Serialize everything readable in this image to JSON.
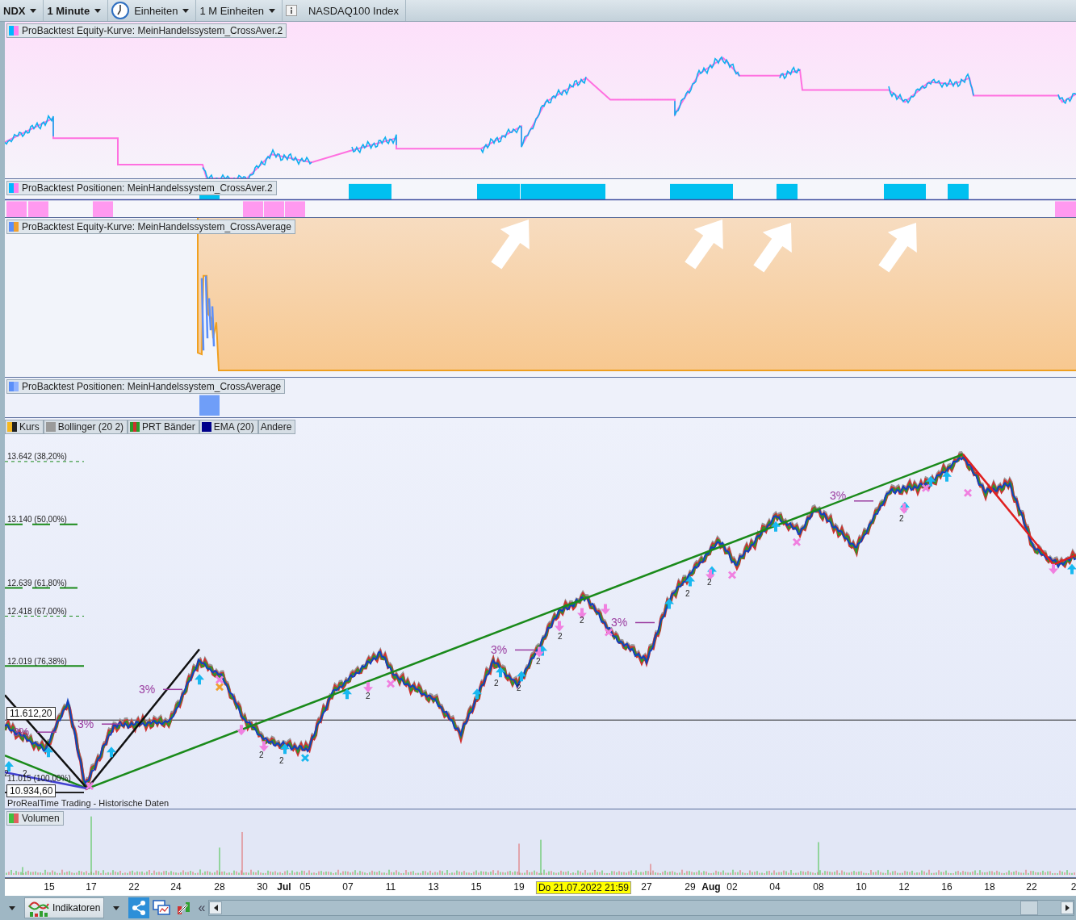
{
  "toolbar": [
    {
      "label": "NDX",
      "kind": "dropdown"
    },
    {
      "label": "1 Minute",
      "kind": "dropdown"
    },
    {
      "label": "Einheiten",
      "kind": "clock"
    },
    {
      "label": "1 M Einheiten",
      "kind": "dropdown"
    },
    {
      "label": "NASDAQ100 Index",
      "kind": "info"
    }
  ],
  "panels": [
    {
      "title": "ProBacktest Equity-Kurve: MeinHandelssystem_CrossAver.2",
      "kind": "equity-pink"
    },
    {
      "title": "ProBacktest Positionen: MeinHandelssystem_CrossAver.2",
      "kind": "positions-cyan"
    },
    {
      "title": "ProBacktest Equity-Kurve: MeinHandelssystem_CrossAverage",
      "kind": "equity-orange"
    },
    {
      "title": "ProBacktest Positionen: MeinHandelssystem_CrossAverage",
      "kind": "positions-blue"
    }
  ],
  "price_chart": {
    "legend": [
      {
        "label": "Kurs",
        "kind": "candles"
      },
      {
        "label": "Bollinger (20 2)",
        "kind": "line",
        "color": "#9a9a9a"
      },
      {
        "label": "PRT Bänder",
        "kind": "bands"
      },
      {
        "label": "EMA (20)",
        "kind": "line",
        "color": "#00008b"
      },
      {
        "label": "Andere",
        "kind": "none"
      }
    ],
    "fib_levels": [
      {
        "label": "13.642 (38,20%)",
        "kind": "dotted"
      },
      {
        "label": "13.140 (50,00%)",
        "kind": "dashed"
      },
      {
        "label": "12.639 (61,80%)",
        "kind": "dashed"
      },
      {
        "label": "12.418 (67,00%)",
        "kind": "dotted"
      },
      {
        "label": "12.019 (76,38%)",
        "kind": "solid"
      },
      {
        "label": "11.015 (100,00%)",
        "kind": "solid"
      }
    ],
    "price_tags": [
      "11.612,20",
      "10.934,60"
    ],
    "percent_marks": [
      "3%",
      "3%",
      "3%",
      "3%",
      "3%",
      "3%"
    ],
    "count_marks": [
      "2",
      "2",
      "2",
      "2",
      "2",
      "2",
      "2",
      "2",
      "2",
      "2",
      "2",
      "2",
      "2"
    ],
    "source": "ProRealTime Trading - Historische Daten"
  },
  "volume": {
    "legend": "Volumen"
  },
  "x_axis": [
    {
      "text": "15",
      "kind": "day"
    },
    {
      "text": "17",
      "kind": "day"
    },
    {
      "text": "22",
      "kind": "day"
    },
    {
      "text": "24",
      "kind": "day"
    },
    {
      "text": "28",
      "kind": "day"
    },
    {
      "text": "30",
      "kind": "day"
    },
    {
      "text": "Jul",
      "kind": "month"
    },
    {
      "text": "05",
      "kind": "day"
    },
    {
      "text": "07",
      "kind": "day"
    },
    {
      "text": "11",
      "kind": "day"
    },
    {
      "text": "13",
      "kind": "day"
    },
    {
      "text": "15",
      "kind": "day"
    },
    {
      "text": "19",
      "kind": "day"
    },
    {
      "text": "Do 21.07.2022 21:59",
      "kind": "cursor"
    },
    {
      "text": "27",
      "kind": "day"
    },
    {
      "text": "29",
      "kind": "day"
    },
    {
      "text": "Aug",
      "kind": "month"
    },
    {
      "text": "02",
      "kind": "day"
    },
    {
      "text": "04",
      "kind": "day"
    },
    {
      "text": "08",
      "kind": "day"
    },
    {
      "text": "10",
      "kind": "day"
    },
    {
      "text": "12",
      "kind": "day"
    },
    {
      "text": "16",
      "kind": "day"
    },
    {
      "text": "18",
      "kind": "day"
    },
    {
      "text": "22",
      "kind": "day"
    },
    {
      "text": "2",
      "kind": "day"
    }
  ],
  "bottom_bar": {
    "indicators": "Indikatoren",
    "back": "«"
  }
}
